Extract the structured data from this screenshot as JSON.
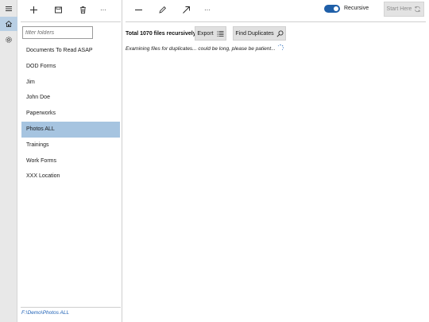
{
  "nav": {
    "menu_icon": "hamburger-icon",
    "home_icon": "home-icon",
    "settings_icon": "gear-icon",
    "selected_color": "#b9cfe4"
  },
  "folder_pane": {
    "toolbar": {
      "add_icon": "plus-icon",
      "save_icon": "save-icon",
      "delete_icon": "trash-icon",
      "more_label": "···"
    },
    "filter_placeholder": "filter folders",
    "folders": [
      {
        "label": "Documents To Read ASAP",
        "selected": false
      },
      {
        "label": "DOD Forms",
        "selected": false
      },
      {
        "label": "Jim",
        "selected": false
      },
      {
        "label": "John Doe",
        "selected": false
      },
      {
        "label": "Paperworks",
        "selected": false
      },
      {
        "label": "Photos ALL",
        "selected": true
      },
      {
        "label": "Trainings",
        "selected": false
      },
      {
        "label": "Work Forms",
        "selected": false
      },
      {
        "label": "XXX Location",
        "selected": false
      }
    ],
    "selection_color": "#a6c4e0",
    "current_path": "F:\\Demo\\Photos ALL"
  },
  "main": {
    "toolbar": {
      "minus_icon": "minus-icon",
      "edit_icon": "pencil-icon",
      "open_icon": "arrow-up-right-icon",
      "more_label": "···",
      "recursive_label": "Recursive",
      "recursive_on": true,
      "toggle_color": "#1f5fa8",
      "start_label": "Start Here",
      "start_icon": "refresh-icon"
    },
    "total_label": "Total 1070 files recursively",
    "export_label": "Export",
    "export_icon": "list-icon",
    "find_duplicates_label": "Find Duplicates",
    "find_icon": "search-icon",
    "status_text": "Examining files for duplicates... could be long, please be patient...",
    "status_icon": "spinner-icon"
  }
}
